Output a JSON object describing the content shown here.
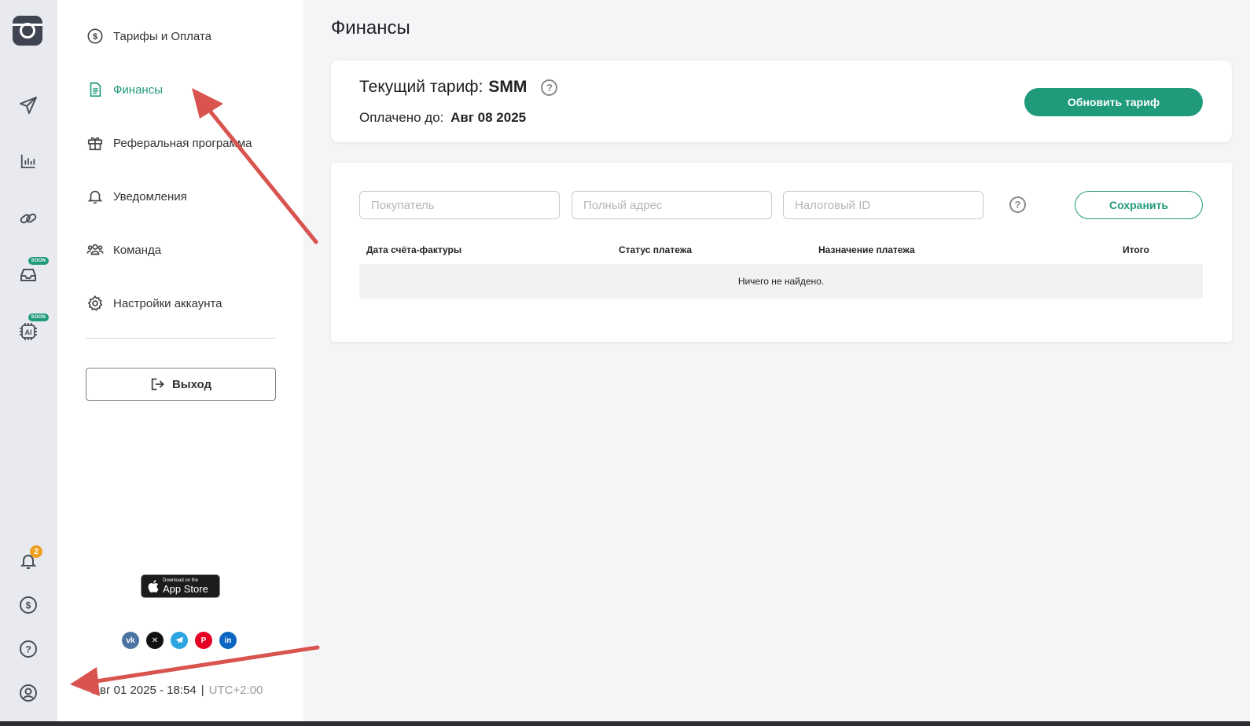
{
  "rail": {
    "notification_count": "2",
    "soon_badges": [
      "SOON",
      "SOON"
    ]
  },
  "menu": {
    "items": [
      {
        "label": "Тарифы и Оплата",
        "icon": "dollar-circle-icon",
        "active": false
      },
      {
        "label": "Финансы",
        "icon": "document-icon",
        "active": true
      },
      {
        "label": "Реферальная программа",
        "icon": "gift-icon",
        "active": false
      },
      {
        "label": "Уведомления",
        "icon": "bell-icon",
        "active": false
      },
      {
        "label": "Команда",
        "icon": "team-icon",
        "active": false
      },
      {
        "label": "Настройки аккаунта",
        "icon": "gear-icon",
        "active": false
      }
    ],
    "logout_label": "Выход"
  },
  "appstore": {
    "small": "Download on the",
    "large": "App Store"
  },
  "socials": [
    "vk",
    "x",
    "telegram",
    "pinterest",
    "linkedin"
  ],
  "footer": {
    "datetime": "Авг 01 2025 - 18:54",
    "separator": "|",
    "timezone": "UTC+2:00"
  },
  "main": {
    "title": "Финансы",
    "tariff": {
      "label": "Текущий тариф:",
      "value": "SMM",
      "paid_label": "Оплачено до:",
      "paid_value": "Авг 08 2025",
      "upgrade_label": "Обновить тариф"
    },
    "billing": {
      "buyer_placeholder": "Покупатель",
      "address_placeholder": "Полный адрес",
      "tax_placeholder": "Налоговый ID",
      "save_label": "Сохранить"
    },
    "table": {
      "columns": [
        "Дата счёта-фактуры",
        "Статус платежа",
        "Назначение платежа",
        "Итого"
      ],
      "empty_text": "Ничего не найдено."
    }
  },
  "colors": {
    "accent": "#1f9a7a",
    "rail_bg": "#e8eaef",
    "page_bg": "#f4f5f7",
    "annotation": "#d9534f"
  }
}
